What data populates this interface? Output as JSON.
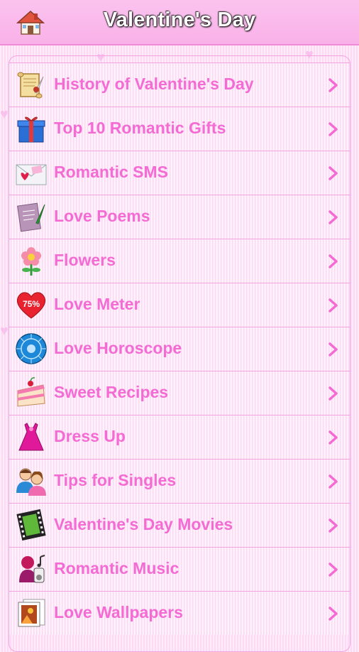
{
  "header": {
    "title": "Valentine's Day",
    "home_icon": "home-icon"
  },
  "menu": {
    "items": [
      {
        "label": "History of Valentine's Day",
        "icon": "scroll-quill-icon"
      },
      {
        "label": "Top 10 Romantic Gifts",
        "icon": "gift-box-icon"
      },
      {
        "label": "Romantic SMS",
        "icon": "envelope-heart-icon"
      },
      {
        "label": "Love Poems",
        "icon": "poem-paper-icon"
      },
      {
        "label": "Flowers",
        "icon": "flower-icon"
      },
      {
        "label": "Love Meter",
        "icon": "heart-percent-icon",
        "icon_text": "75%"
      },
      {
        "label": "Love Horoscope",
        "icon": "zodiac-wheel-icon"
      },
      {
        "label": "Sweet Recipes",
        "icon": "cake-slice-icon"
      },
      {
        "label": "Dress Up",
        "icon": "dress-icon"
      },
      {
        "label": "Tips for Singles",
        "icon": "couple-icon"
      },
      {
        "label": "Valentine's Day Movies",
        "icon": "film-reel-icon"
      },
      {
        "label": "Romantic Music",
        "icon": "music-player-icon"
      },
      {
        "label": "Love Wallpapers",
        "icon": "wallpaper-picture-icon"
      }
    ]
  },
  "colors": {
    "accent_text": "#f46bd3",
    "header_bg": "#fbc3ee",
    "row_border": "#f3a4e0"
  }
}
